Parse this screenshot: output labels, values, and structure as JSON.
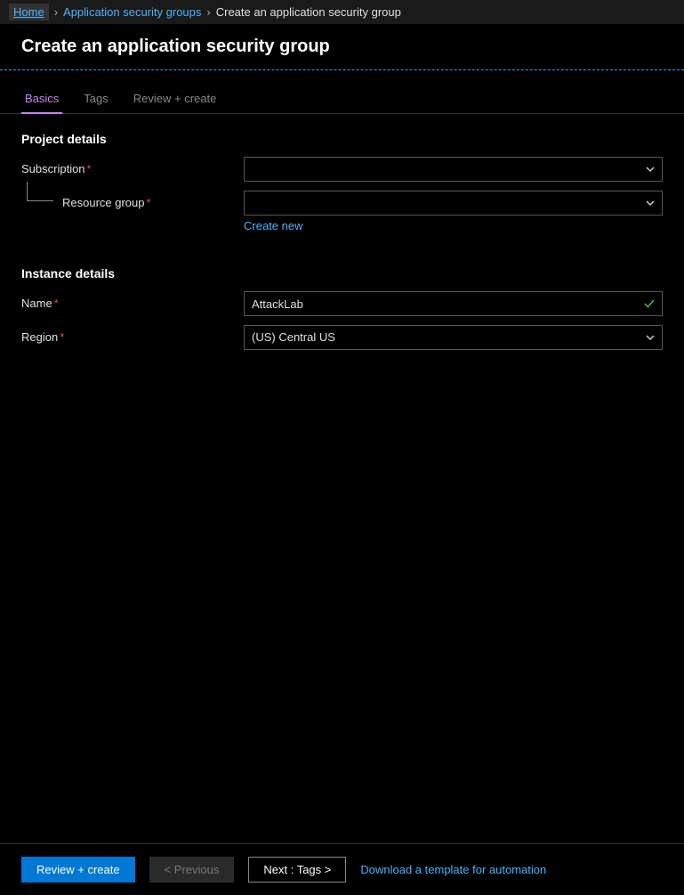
{
  "breadcrumb": {
    "home": "Home",
    "level1": "Application security groups",
    "current": "Create an application security group"
  },
  "page_title": "Create an application security group",
  "tabs": [
    {
      "label": "Basics",
      "active": true
    },
    {
      "label": "Tags",
      "active": false
    },
    {
      "label": "Review + create",
      "active": false
    }
  ],
  "sections": {
    "project_details": {
      "title": "Project details",
      "subscription": {
        "label": "Subscription",
        "value": ""
      },
      "resource_group": {
        "label": "Resource group",
        "value": "",
        "create_new": "Create new"
      }
    },
    "instance_details": {
      "title": "Instance details",
      "name": {
        "label": "Name",
        "value": "AttackLab"
      },
      "region": {
        "label": "Region",
        "value": "(US) Central US"
      }
    }
  },
  "footer": {
    "review_create": "Review + create",
    "previous": "< Previous",
    "next": "Next : Tags >",
    "download": "Download a template for automation"
  }
}
